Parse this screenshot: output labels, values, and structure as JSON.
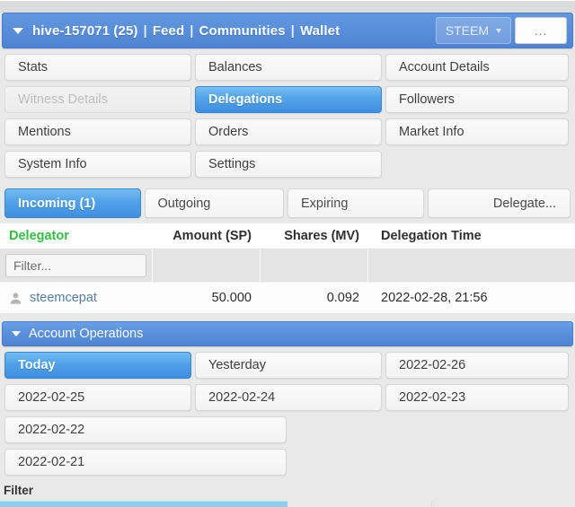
{
  "header": {
    "expand_icon": "caret-down-icon",
    "account": "hive-157071 (25)",
    "sep": "|",
    "feed": "Feed",
    "communities": "Communities",
    "wallet": "Wallet",
    "chain_selector": "STEEM",
    "more_button": "..."
  },
  "nav": {
    "items": [
      {
        "label": "Stats",
        "state": "normal"
      },
      {
        "label": "Balances",
        "state": "normal"
      },
      {
        "label": "Account Details",
        "state": "normal"
      },
      {
        "label": "Witness Details",
        "state": "disabled"
      },
      {
        "label": "Delegations",
        "state": "active"
      },
      {
        "label": "Followers",
        "state": "normal"
      },
      {
        "label": "Mentions",
        "state": "normal"
      },
      {
        "label": "Orders",
        "state": "normal"
      },
      {
        "label": "Market Info",
        "state": "normal"
      },
      {
        "label": "System Info",
        "state": "normal"
      },
      {
        "label": "Settings",
        "state": "normal"
      },
      {
        "label": "",
        "state": "empty"
      }
    ]
  },
  "delegation_tabs": [
    {
      "label": "Incoming (1)",
      "state": "active"
    },
    {
      "label": "Outgoing",
      "state": "normal"
    },
    {
      "label": "Expiring",
      "state": "normal"
    },
    {
      "label": "Delegate...",
      "state": "normal"
    }
  ],
  "delegation_table": {
    "columns": [
      "Delegator",
      "Amount (SP)",
      "Shares (MV)",
      "Delegation Time"
    ],
    "header_accent_color": "#33bb44",
    "filter_placeholder": "Filter...",
    "filter_value": "",
    "rows": [
      {
        "icon": "person-icon",
        "delegator": "steemcepat",
        "amount_sp": "50.000",
        "shares_mv": "0.092",
        "delegation_time": "2022-02-28, 21:56"
      }
    ]
  },
  "account_operations": {
    "expand_icon": "caret-down-icon",
    "title": "Account Operations",
    "date_tabs": [
      {
        "label": "Today",
        "state": "active"
      },
      {
        "label": "Yesterday",
        "state": "normal"
      },
      {
        "label": "2022-02-26",
        "state": "normal"
      },
      {
        "label": "2022-02-25",
        "state": "normal"
      },
      {
        "label": "2022-02-24",
        "state": "normal"
      },
      {
        "label": "2022-02-23",
        "state": "normal"
      },
      {
        "label": "2022-02-22",
        "state": "normal"
      },
      {
        "label": "2022-02-21",
        "state": "normal"
      }
    ],
    "filter_label": "Filter"
  },
  "colors": {
    "brand_blue": "#4e83d4",
    "active_blue": "#3d8ee0",
    "green_accent": "#33bb44",
    "link_blue": "#5a7da0",
    "progress_blue": "#8dcdee"
  }
}
